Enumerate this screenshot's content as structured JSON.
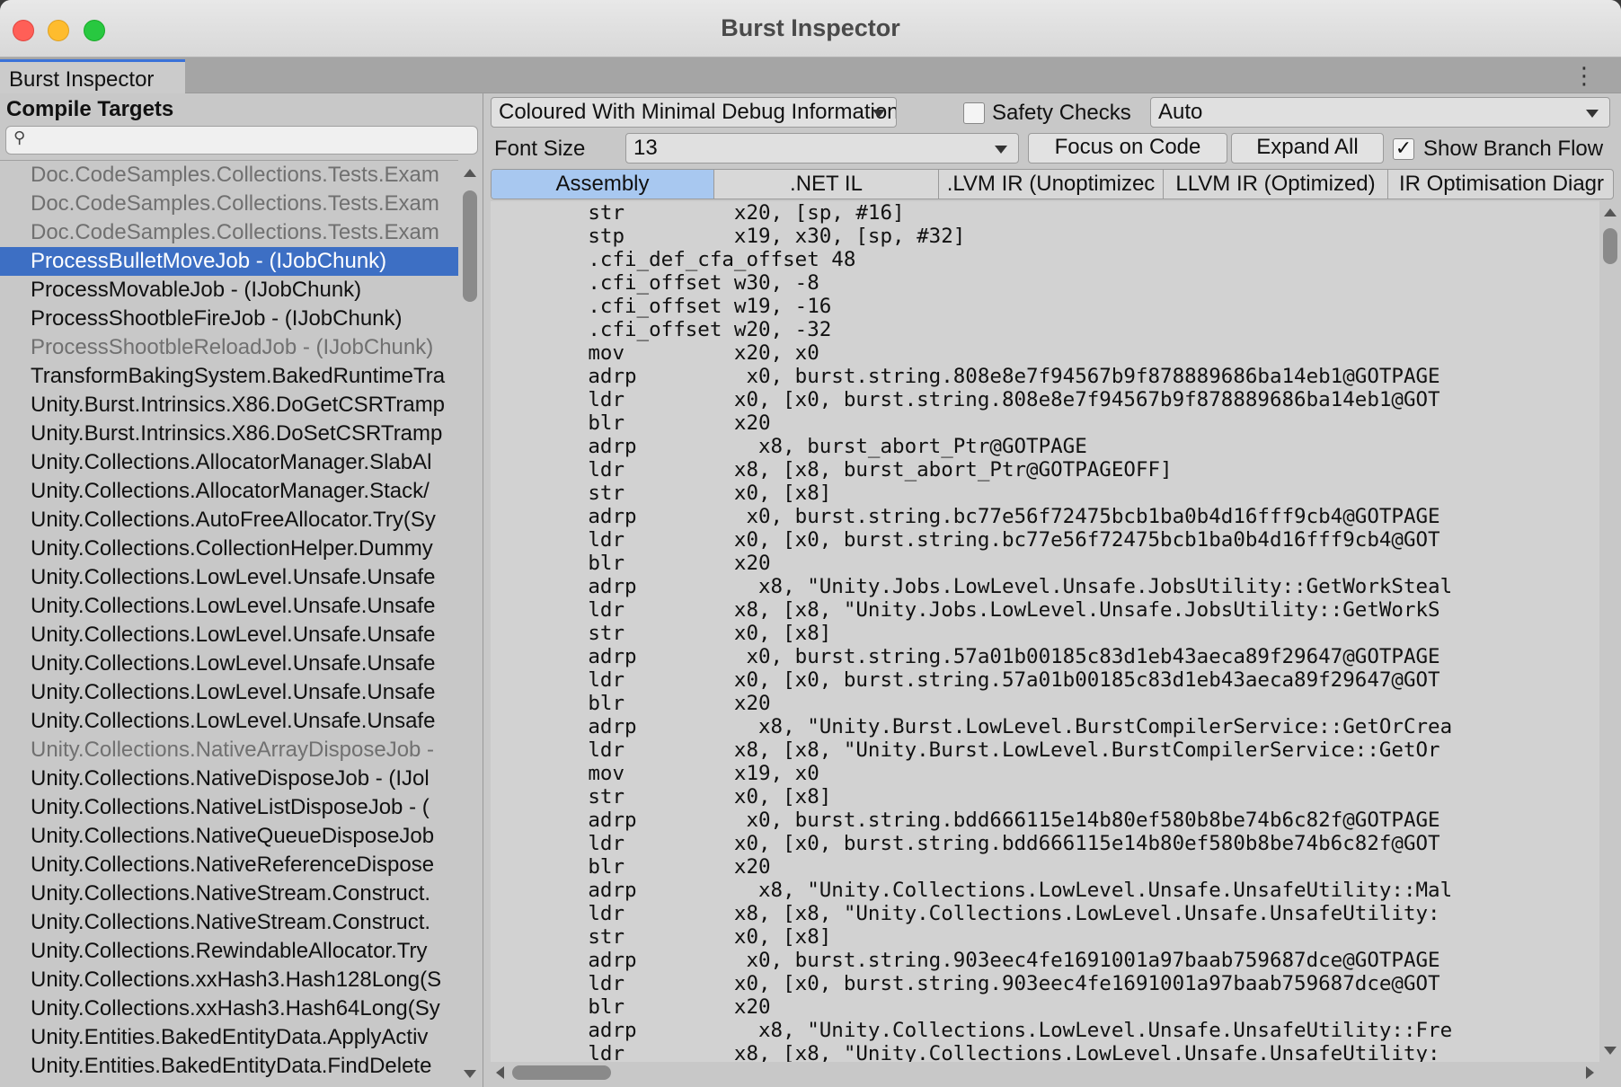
{
  "window": {
    "title": "Burst Inspector"
  },
  "tab": {
    "label": "Burst Inspector"
  },
  "sidebar": {
    "heading": "Compile Targets",
    "search_placeholder": "",
    "items": [
      {
        "label": "Doc.CodeSamples.Collections.Tests.Exam",
        "state": "dim"
      },
      {
        "label": "Doc.CodeSamples.Collections.Tests.Exam",
        "state": "dim"
      },
      {
        "label": "Doc.CodeSamples.Collections.Tests.Exam",
        "state": "dim"
      },
      {
        "label": "ProcessBulletMoveJob - (IJobChunk)",
        "state": "selected"
      },
      {
        "label": "ProcessMovableJob - (IJobChunk)",
        "state": "normal"
      },
      {
        "label": "ProcessShootbleFireJob - (IJobChunk)",
        "state": "normal"
      },
      {
        "label": "ProcessShootbleReloadJob - (IJobChunk)",
        "state": "dim"
      },
      {
        "label": "TransformBakingSystem.BakedRuntimeTra",
        "state": "normal"
      },
      {
        "label": "Unity.Burst.Intrinsics.X86.DoGetCSRTramp",
        "state": "normal"
      },
      {
        "label": "Unity.Burst.Intrinsics.X86.DoSetCSRTramp",
        "state": "normal"
      },
      {
        "label": "Unity.Collections.AllocatorManager.SlabAl",
        "state": "normal"
      },
      {
        "label": "Unity.Collections.AllocatorManager.Stack/",
        "state": "normal"
      },
      {
        "label": "Unity.Collections.AutoFreeAllocator.Try(Sy",
        "state": "normal"
      },
      {
        "label": "Unity.Collections.CollectionHelper.Dummy",
        "state": "normal"
      },
      {
        "label": "Unity.Collections.LowLevel.Unsafe.Unsafe",
        "state": "normal"
      },
      {
        "label": "Unity.Collections.LowLevel.Unsafe.Unsafe",
        "state": "normal"
      },
      {
        "label": "Unity.Collections.LowLevel.Unsafe.Unsafe",
        "state": "normal"
      },
      {
        "label": "Unity.Collections.LowLevel.Unsafe.Unsafe",
        "state": "normal"
      },
      {
        "label": "Unity.Collections.LowLevel.Unsafe.Unsafe",
        "state": "normal"
      },
      {
        "label": "Unity.Collections.LowLevel.Unsafe.Unsafe",
        "state": "normal"
      },
      {
        "label": "Unity.Collections.NativeArrayDisposeJob -",
        "state": "dim"
      },
      {
        "label": "Unity.Collections.NativeDisposeJob - (IJol",
        "state": "normal"
      },
      {
        "label": "Unity.Collections.NativeListDisposeJob - (",
        "state": "normal"
      },
      {
        "label": "Unity.Collections.NativeQueueDisposeJob",
        "state": "normal"
      },
      {
        "label": "Unity.Collections.NativeReferenceDispose",
        "state": "normal"
      },
      {
        "label": "Unity.Collections.NativeStream.Construct.",
        "state": "normal"
      },
      {
        "label": "Unity.Collections.NativeStream.Construct.",
        "state": "normal"
      },
      {
        "label": "Unity.Collections.RewindableAllocator.Try",
        "state": "normal"
      },
      {
        "label": "Unity.Collections.xxHash3.Hash128Long(S",
        "state": "normal"
      },
      {
        "label": "Unity.Collections.xxHash3.Hash64Long(Sy",
        "state": "normal"
      },
      {
        "label": "Unity.Entities.BakedEntityData.ApplyActiv",
        "state": "normal"
      },
      {
        "label": "Unity.Entities.BakedEntityData.FindDelete",
        "state": "normal"
      }
    ]
  },
  "toolbar": {
    "output_mode": "Coloured With Minimal Debug Information",
    "safety_checks_label": "Safety Checks",
    "safety_checks_checked": false,
    "target_dropdown": "Auto",
    "font_size_label": "Font Size",
    "font_size_value": "13",
    "focus_button": "Focus on Code",
    "expand_button": "Expand All",
    "branch_flow_label": "Show Branch Flow",
    "branch_flow_checked": true
  },
  "view_tabs": [
    {
      "label": "Assembly",
      "active": true
    },
    {
      "label": ".NET IL",
      "active": false
    },
    {
      "label": ".LVM IR (Unoptimizec",
      "active": false
    },
    {
      "label": "LLVM IR (Optimized)",
      "active": false
    },
    {
      "label": "IR Optimisation Diagr",
      "active": false
    }
  ],
  "code_lines": [
    "        str         x20, [sp, #16]",
    "        stp         x19, x30, [sp, #32]",
    "        .cfi_def_cfa_offset 48",
    "        .cfi_offset w30, -8",
    "        .cfi_offset w19, -16",
    "        .cfi_offset w20, -32",
    "        mov         x20, x0",
    "        adrp         x0, burst.string.808e8e7f94567b9f878889686ba14eb1@GOTPAGE",
    "        ldr         x0, [x0, burst.string.808e8e7f94567b9f878889686ba14eb1@GOT",
    "        blr         x20",
    "        adrp          x8, burst_abort_Ptr@GOTPAGE",
    "        ldr         x8, [x8, burst_abort_Ptr@GOTPAGEOFF]",
    "        str         x0, [x8]",
    "        adrp         x0, burst.string.bc77e56f72475bcb1ba0b4d16fff9cb4@GOTPAGE",
    "        ldr         x0, [x0, burst.string.bc77e56f72475bcb1ba0b4d16fff9cb4@GOT",
    "        blr         x20",
    "        adrp          x8, \"Unity.Jobs.LowLevel.Unsafe.JobsUtility::GetWorkSteal",
    "        ldr         x8, [x8, \"Unity.Jobs.LowLevel.Unsafe.JobsUtility::GetWorkS",
    "        str         x0, [x8]",
    "        adrp         x0, burst.string.57a01b00185c83d1eb43aeca89f29647@GOTPAGE",
    "        ldr         x0, [x0, burst.string.57a01b00185c83d1eb43aeca89f29647@GOT",
    "        blr         x20",
    "        adrp          x8, \"Unity.Burst.LowLevel.BurstCompilerService::GetOrCrea",
    "        ldr         x8, [x8, \"Unity.Burst.LowLevel.BurstCompilerService::GetOr",
    "        mov         x19, x0",
    "        str         x0, [x8]",
    "        adrp         x0, burst.string.bdd666115e14b80ef580b8be74b6c82f@GOTPAGE",
    "        ldr         x0, [x0, burst.string.bdd666115e14b80ef580b8be74b6c82f@GOT",
    "        blr         x20",
    "        adrp          x8, \"Unity.Collections.LowLevel.Unsafe.UnsafeUtility::Mal",
    "        ldr         x8, [x8, \"Unity.Collections.LowLevel.Unsafe.UnsafeUtility:",
    "        str         x0, [x8]",
    "        adrp         x0, burst.string.903eec4fe1691001a97baab759687dce@GOTPAGE",
    "        ldr         x0, [x0, burst.string.903eec4fe1691001a97baab759687dce@GOT",
    "        blr         x20",
    "        adrp          x8, \"Unity.Collections.LowLevel.Unsafe.UnsafeUtility::Fre",
    "        ldr         x8, [x8, \"Unity.Collections.LowLevel.Unsafe.UnsafeUtility:"
  ],
  "colors": {
    "selection": "#3d6fc4",
    "active_tab": "#a8c8f0",
    "tab_underline": "#3a72d8"
  }
}
